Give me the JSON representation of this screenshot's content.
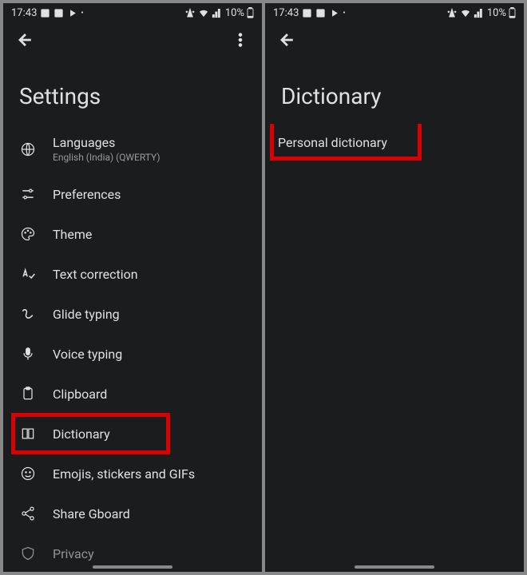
{
  "status": {
    "time": "17:43",
    "battery": "10%"
  },
  "left": {
    "title": "Settings",
    "items": [
      {
        "label": "Languages",
        "sublabel": "English (India) (QWERTY)"
      },
      {
        "label": "Preferences"
      },
      {
        "label": "Theme"
      },
      {
        "label": "Text correction"
      },
      {
        "label": "Glide typing"
      },
      {
        "label": "Voice typing"
      },
      {
        "label": "Clipboard"
      },
      {
        "label": "Dictionary"
      },
      {
        "label": "Emojis, stickers and GIFs"
      },
      {
        "label": "Share Gboard"
      },
      {
        "label": "Privacy"
      }
    ]
  },
  "right": {
    "title": "Dictionary",
    "items": [
      {
        "label": "Personal dictionary"
      }
    ]
  }
}
